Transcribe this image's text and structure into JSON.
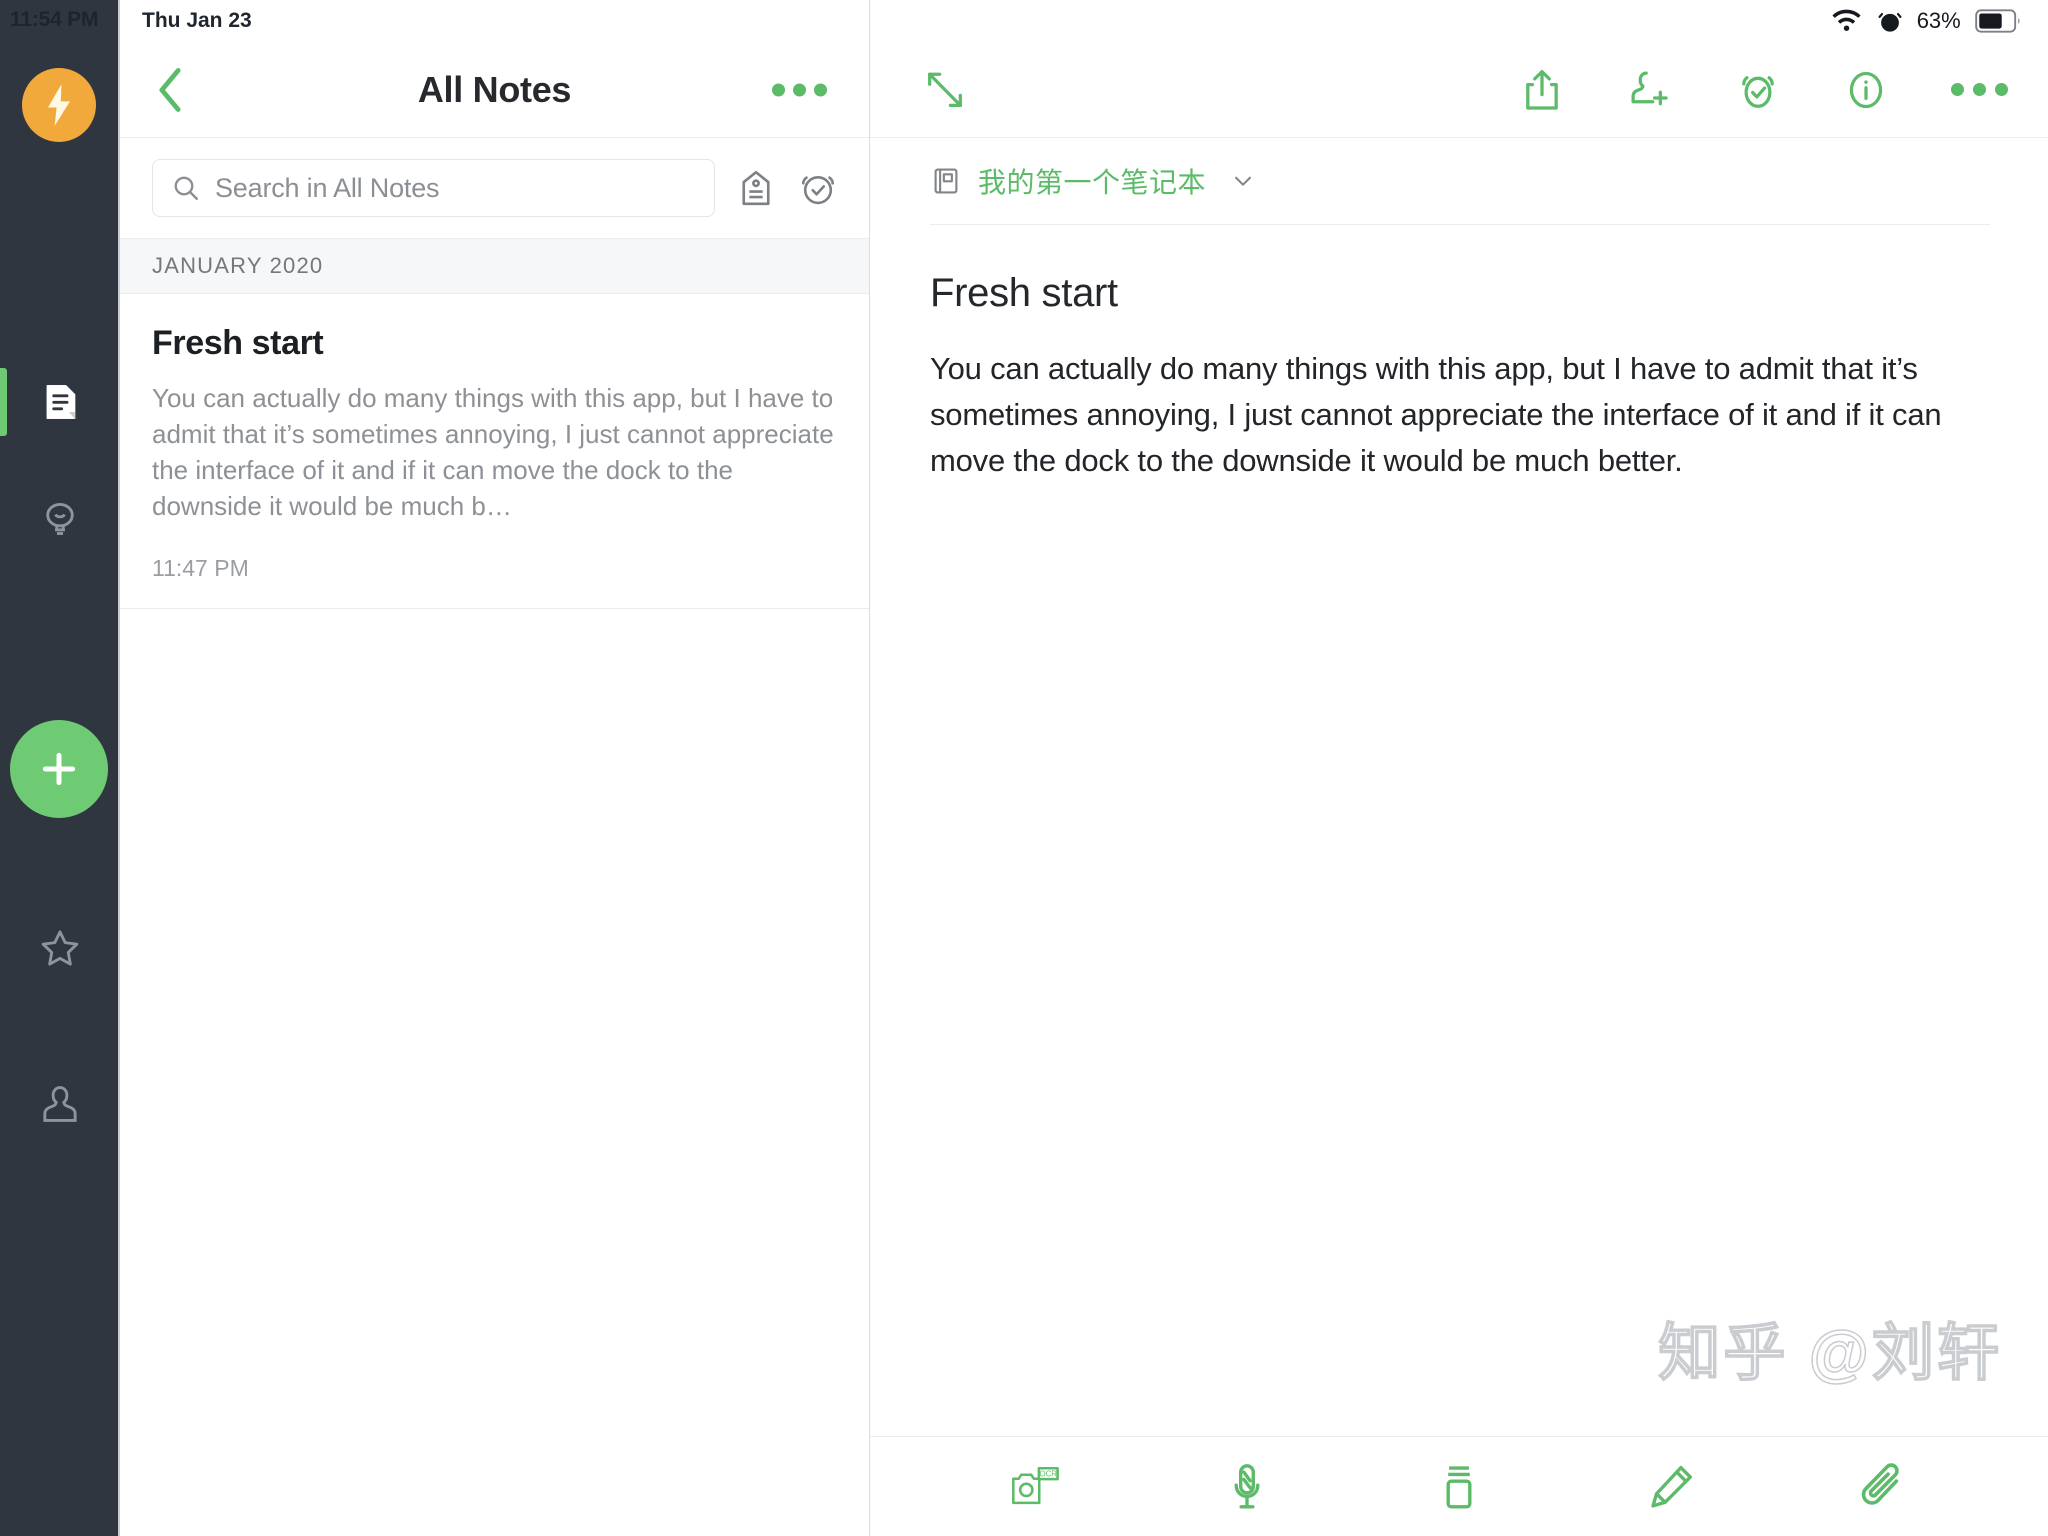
{
  "status_bar": {
    "time": "11:54 PM",
    "date": "Thu Jan 23",
    "battery_percent": "63%",
    "wifi_icon": "wifi-icon",
    "alarm_icon": "alarm-icon",
    "battery_icon": "battery-icon"
  },
  "colors": {
    "accent_green": "#5cbb68",
    "fab_green": "#6ecb73",
    "rail_dark": "#2f3640",
    "logo_orange": "#f2a93b",
    "muted_gray": "#8d9196"
  },
  "rail": {
    "logo_icon": "bolt-logo-icon",
    "items": [
      {
        "icon": "notes-icon",
        "label": "Notes",
        "active": true
      },
      {
        "icon": "lightbulb-icon",
        "label": "Ideas",
        "active": false
      },
      {
        "icon": "star-icon",
        "label": "Shortcuts",
        "active": false
      },
      {
        "icon": "account-icon",
        "label": "Account",
        "active": false
      }
    ],
    "fab": {
      "icon": "plus-icon",
      "label": "New note"
    }
  },
  "list_pane": {
    "back_label": "Back",
    "title": "All Notes",
    "more_label": "More options",
    "search": {
      "placeholder": "Search in All Notes",
      "value": "",
      "icon": "search-icon"
    },
    "tag_button": {
      "icon": "tag-icon",
      "label": "Tags"
    },
    "reminder_button": {
      "icon": "alarm-check-icon",
      "label": "Reminders"
    },
    "section_header": "JANUARY 2020",
    "notes": [
      {
        "title": "Fresh start",
        "preview": "You can actually do many things with this app, but I have to admit that it’s sometimes annoying, I just cannot appreciate the interface of it and if it can move the dock to the downside it would be much b…",
        "time": "11:47 PM"
      }
    ]
  },
  "detail_pane": {
    "expand_button": {
      "icon": "expand-arrows-icon",
      "label": "Expand"
    },
    "toolbar": [
      {
        "icon": "share-icon",
        "label": "Share"
      },
      {
        "icon": "add-person-icon",
        "label": "Invite"
      },
      {
        "icon": "alarm-check-icon",
        "label": "Reminder"
      },
      {
        "icon": "info-icon",
        "label": "Info"
      },
      {
        "icon": "more-dots-icon",
        "label": "More"
      }
    ],
    "breadcrumb": {
      "notebook_icon": "notebook-icon",
      "notebook_name": "我的第一个笔记本",
      "chevron_icon": "chevron-down-icon"
    },
    "note": {
      "title": "Fresh start",
      "body": "You can actually do many things with this app, but I have to admit that it’s sometimes annoying, I just cannot appreciate the interface of it and if it can move the dock to the downside it would be much better."
    },
    "bottom_toolbar": [
      {
        "icon": "camera-ocr-icon",
        "label": "OCR",
        "badge": "OCR"
      },
      {
        "icon": "microphone-icon",
        "label": "Audio"
      },
      {
        "icon": "checklist-icon",
        "label": "To-do"
      },
      {
        "icon": "pencil-icon",
        "label": "Handwrite"
      },
      {
        "icon": "paperclip-icon",
        "label": "Attach"
      }
    ]
  },
  "watermark": {
    "text": "知乎 @刘轩"
  }
}
